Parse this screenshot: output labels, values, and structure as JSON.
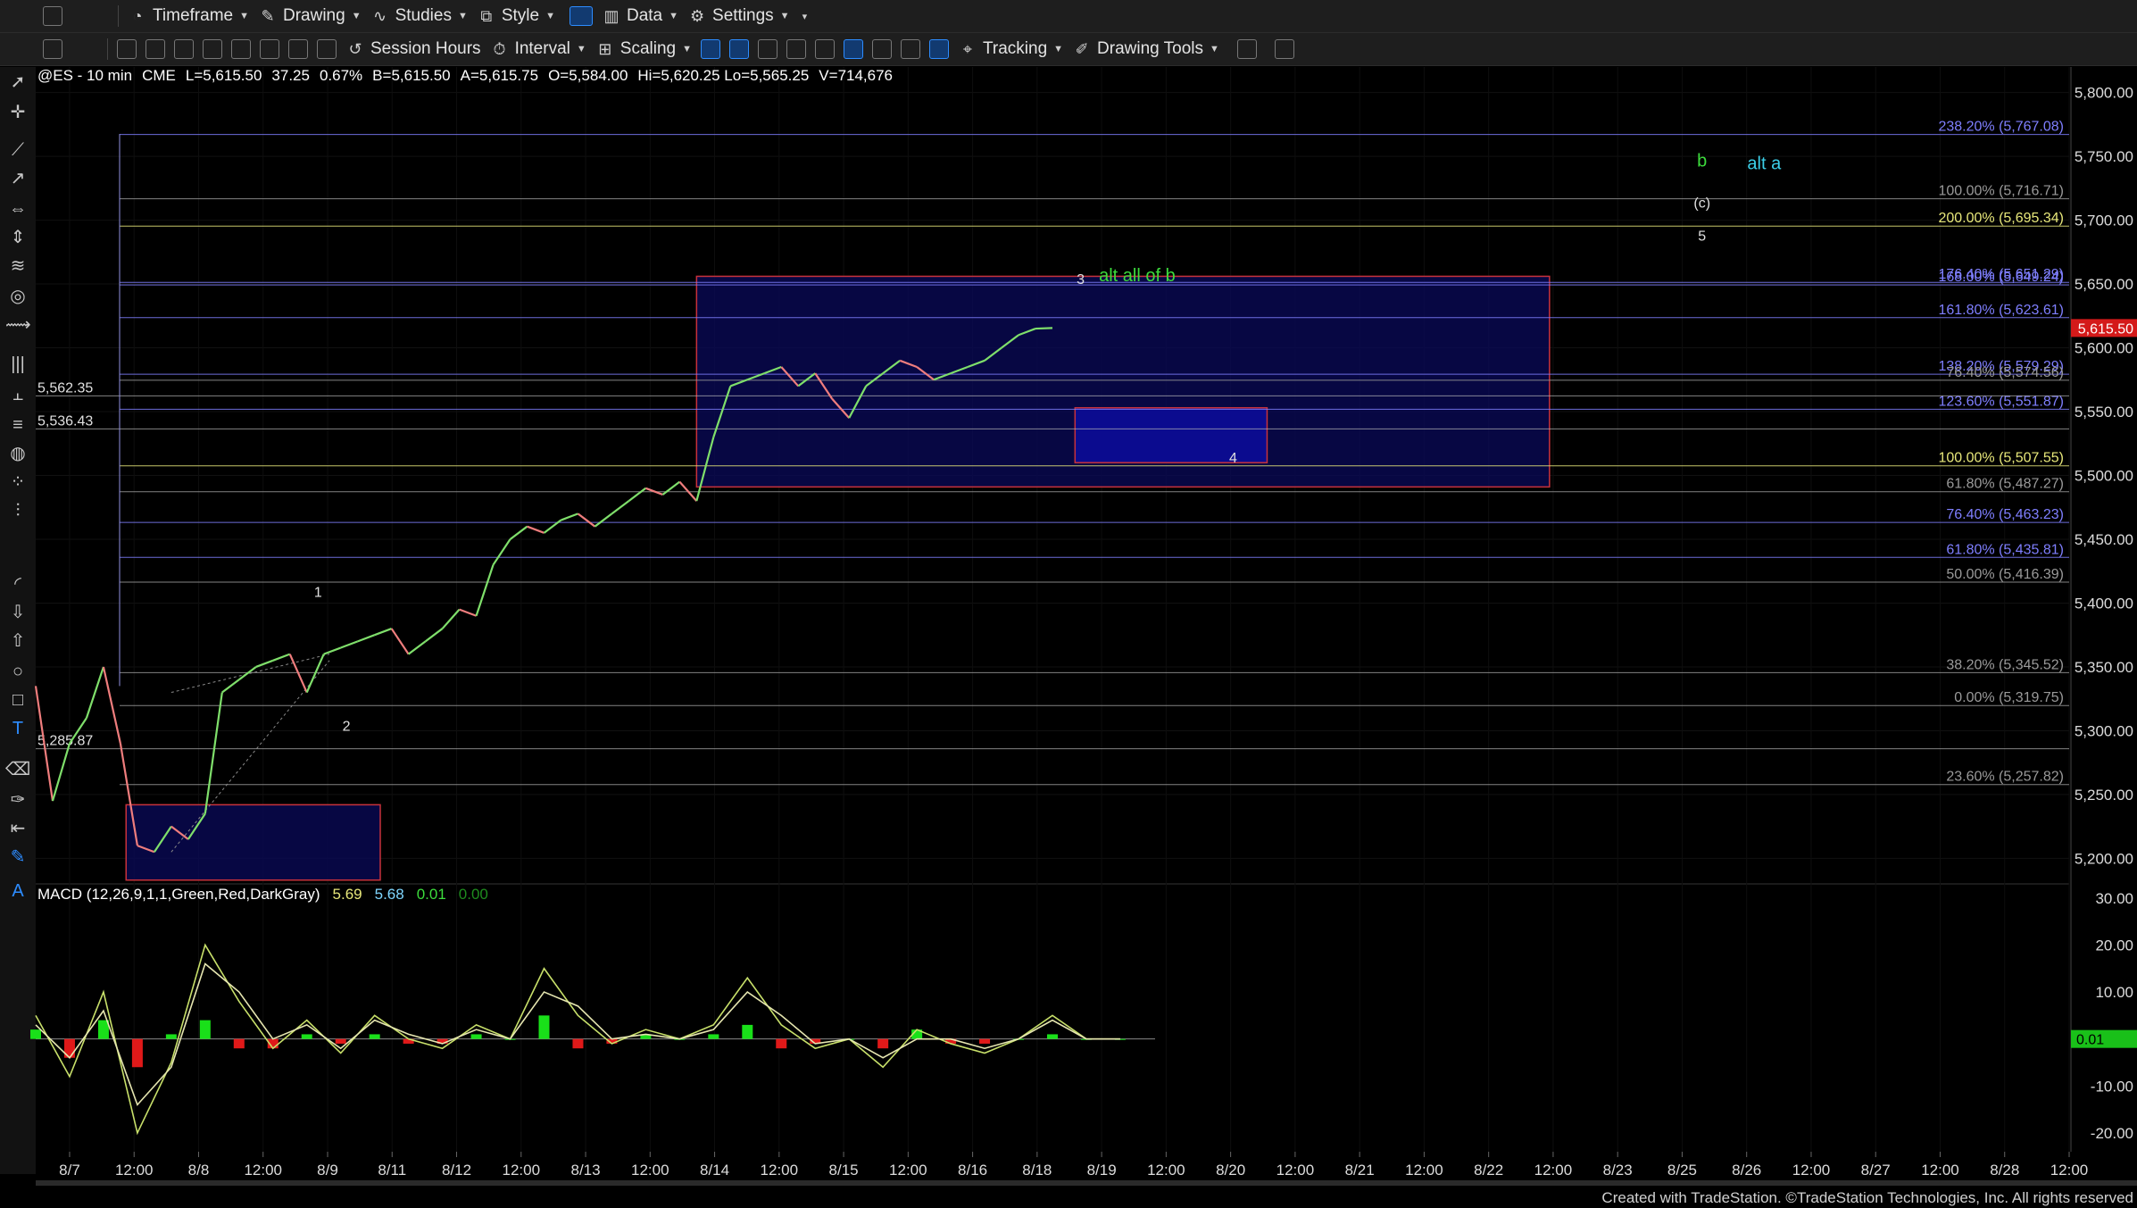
{
  "toolbar_top": {
    "timeframe": "Timeframe",
    "drawing": "Drawing",
    "studies": "Studies",
    "style": "Style",
    "data": "Data",
    "settings": "Settings"
  },
  "toolbar_second": {
    "session_hours": "Session Hours",
    "interval": "Interval",
    "scaling": "Scaling",
    "tracking": "Tracking",
    "drawing_tools": "Drawing Tools"
  },
  "symbol_header": {
    "symbol": "@ES - 10 min",
    "exchange": "CME",
    "last": "L=5,615.50",
    "change": "37.25",
    "change_pct": "0.67%",
    "bid": "B=5,615.50",
    "ask": "A=5,615.75",
    "open": "O=5,584.00",
    "hi_lo": "Hi=5,620.25  Lo=5,565.25",
    "volume": "V=714,676"
  },
  "macd_header": {
    "label": "MACD (12,26,9,1,1,Green,Red,DarkGray)",
    "macd": "5.69",
    "signal": "5.68",
    "diff": "0.01",
    "zero": "0.00"
  },
  "footer": {
    "text": "Created with TradeStation. ©TradeStation Technologies, Inc. All rights reserved"
  },
  "colors": {
    "price_up": "#7fdf6b",
    "price_down": "#ef7d7d",
    "fib_blue": "#7f7fff",
    "fib_yellow": "#e8e87a",
    "fib_gray": "#9a9a9a",
    "box_red": "#c8323c",
    "box_fill": "#0a0a5a",
    "label_green": "#3cdc3c",
    "label_cyan": "#3ccfe8",
    "last_price_bg": "#d41a1a"
  },
  "chart_data": {
    "type": "line",
    "title": "@ES - 10 min",
    "price_axis": {
      "ylim": [
        5180,
        5820
      ],
      "ticks": [
        "5,800.00",
        "5,750.00",
        "5,700.00",
        "5,650.00",
        "5,600.00",
        "5,550.00",
        "5,500.00",
        "5,450.00",
        "5,400.00",
        "5,350.00",
        "5,300.00",
        "5,250.00",
        "5,200.00"
      ],
      "tick_values": [
        5800,
        5750,
        5700,
        5650,
        5600,
        5550,
        5500,
        5450,
        5400,
        5350,
        5300,
        5250,
        5200
      ],
      "last_price_label": "5,615.50",
      "last_price": 5615.5
    },
    "time_axis": {
      "labels": [
        "8/7",
        "12:00",
        "8/8",
        "12:00",
        "8/9",
        "8/11",
        "8/12",
        "12:00",
        "8/13",
        "12:00",
        "8/14",
        "12:00",
        "8/15",
        "12:00",
        "8/16",
        "8/18",
        "8/19",
        "12:00",
        "8/20",
        "12:00",
        "8/21",
        "12:00",
        "8/22",
        "12:00",
        "8/23",
        "8/25",
        "8/26",
        "12:00",
        "8/27",
        "12:00",
        "8/28",
        "12:00"
      ],
      "xlim": [
        0,
        36
      ]
    },
    "price_series": {
      "name": "@ES",
      "x": [
        0,
        0.3,
        0.6,
        0.9,
        1.2,
        1.5,
        1.8,
        2.1,
        2.4,
        2.7,
        3.0,
        3.3,
        3.6,
        3.9,
        4.2,
        4.5,
        4.8,
        5.1,
        5.4,
        5.7,
        6.0,
        6.3,
        6.6,
        6.9,
        7.2,
        7.5,
        7.8,
        8.1,
        8.4,
        8.7,
        9.0,
        9.3,
        9.6,
        9.9,
        10.2,
        10.5,
        10.8,
        11.1,
        11.4,
        11.7,
        12.0,
        12.3,
        12.6,
        12.9,
        13.2,
        13.5,
        13.8,
        14.1,
        14.4,
        14.7,
        15.0,
        15.3,
        15.6,
        15.9,
        16.2,
        16.5,
        16.8,
        17.1,
        17.4,
        17.7,
        18.0,
        18.3,
        18.6,
        18.9,
        19.2
      ],
      "values": [
        5335,
        5245,
        5290,
        5310,
        5350,
        5290,
        5210,
        5205,
        5225,
        5215,
        5235,
        5330,
        5340,
        5350,
        5355,
        5360,
        5330,
        5360,
        5365,
        5370,
        5375,
        5380,
        5360,
        5370,
        5380,
        5395,
        5390,
        5430,
        5450,
        5460,
        5455,
        5465,
        5470,
        5460,
        5470,
        5480,
        5490,
        5485,
        5495,
        5480,
        5530,
        5570,
        5575,
        5580,
        5585,
        5570,
        5580,
        5560,
        5545,
        5570,
        5580,
        5590,
        5585,
        5575,
        5580,
        5585,
        5590,
        5600,
        5610,
        5615,
        5615.5,
        null,
        null,
        null,
        null
      ]
    },
    "horizontal_levels": [
      {
        "label": "238.20% (5,767.08)",
        "value": 5767.08,
        "color": "fib_blue"
      },
      {
        "label": "100.00% (5,716.71)",
        "value": 5716.71,
        "color": "fib_gray"
      },
      {
        "label": "200.00% (5,695.34)",
        "value": 5695.34,
        "color": "fib_yellow"
      },
      {
        "label": "176.40% (5,651.29)",
        "value": 5651.29,
        "color": "fib_blue"
      },
      {
        "label": "168.00% (5,649.24)",
        "value": 5649.24,
        "color": "fib_blue"
      },
      {
        "label": "161.80% (5,623.61)",
        "value": 5623.61,
        "color": "fib_blue"
      },
      {
        "label": "138.20% (5,579.29)",
        "value": 5579.29,
        "color": "fib_blue"
      },
      {
        "label": "76.40% (5,574.56)",
        "value": 5574.56,
        "color": "fib_gray"
      },
      {
        "label": "123.60% (5,551.87)",
        "value": 5551.87,
        "color": "fib_blue"
      },
      {
        "label": "100.00% (5,507.55)",
        "value": 5507.55,
        "color": "fib_yellow"
      },
      {
        "label": "61.80% (5,487.27)",
        "value": 5487.27,
        "color": "fib_gray"
      },
      {
        "label": "76.40% (5,463.23)",
        "value": 5463.23,
        "color": "fib_blue"
      },
      {
        "label": "61.80% (5,435.81)",
        "value": 5435.81,
        "color": "fib_blue"
      },
      {
        "label": "50.00% (5,416.39)",
        "value": 5416.39,
        "color": "fib_gray"
      },
      {
        "label": "38.20% (5,345.52)",
        "value": 5345.52,
        "color": "fib_gray"
      },
      {
        "label": "0.00% (5,319.75)",
        "value": 5319.75,
        "color": "fib_gray"
      },
      {
        "label": "23.60% (5,257.82)",
        "value": 5257.82,
        "color": "fib_gray"
      }
    ],
    "left_price_labels": [
      {
        "label": "5,562.35",
        "value": 5562.35
      },
      {
        "label": "5,536.43",
        "value": 5536.43
      },
      {
        "label": "5,285.87",
        "value": 5285.87
      }
    ],
    "wave_labels": [
      {
        "text": "1",
        "x": 5.0,
        "value": 5405
      },
      {
        "text": "2",
        "x": 5.5,
        "value": 5300
      },
      {
        "text": "3",
        "x": 18.5,
        "value": 5650
      },
      {
        "text": "alt all of b",
        "x": 19.5,
        "value": 5652
      },
      {
        "text": "4",
        "x": 21.2,
        "value": 5510
      },
      {
        "text": "b",
        "x": 29.5,
        "value": 5742
      },
      {
        "text": "alt a",
        "x": 30.6,
        "value": 5740
      },
      {
        "text": "(c)",
        "x": 29.5,
        "value": 5710
      },
      {
        "text": "5",
        "x": 29.5,
        "value": 5684
      }
    ],
    "boxes": [
      {
        "x0": 11.7,
        "x1": 26.8,
        "y0": 5491,
        "y1": 5656,
        "kind": "target-zone"
      },
      {
        "x0": 18.4,
        "x1": 21.8,
        "y0": 5510,
        "y1": 5553,
        "kind": "wave-4-zone"
      },
      {
        "x0": 1.6,
        "x1": 6.1,
        "y0": 5183,
        "y1": 5242,
        "kind": "support-zone"
      }
    ],
    "macd": {
      "axis_ticks": [
        "30.00",
        "20.00",
        "10.00",
        "0.00",
        "-10.00",
        "-20.00"
      ],
      "axis_values": [
        30,
        20,
        10,
        0,
        -10,
        -20
      ],
      "ylim": [
        -24,
        33
      ],
      "current_label": "0.01",
      "x": [
        0,
        0.6,
        1.2,
        1.8,
        2.4,
        3.0,
        3.6,
        4.2,
        4.8,
        5.4,
        6.0,
        6.6,
        7.2,
        7.8,
        8.4,
        9.0,
        9.6,
        10.2,
        10.8,
        11.4,
        12.0,
        12.6,
        13.2,
        13.8,
        14.4,
        15.0,
        15.6,
        16.2,
        16.8,
        17.4,
        18.0,
        18.6,
        19.2
      ],
      "macd_values": [
        5,
        -8,
        10,
        -20,
        -5,
        20,
        8,
        -2,
        4,
        -3,
        5,
        0,
        -2,
        3,
        0,
        15,
        5,
        -1,
        2,
        0,
        3,
        13,
        3,
        -2,
        0,
        -6,
        2,
        -1,
        -3,
        0,
        5,
        0,
        0
      ],
      "signal_values": [
        3,
        -4,
        6,
        -14,
        -6,
        16,
        10,
        0,
        3,
        -2,
        4,
        1,
        -1,
        2,
        0,
        10,
        7,
        0,
        1,
        0,
        2,
        10,
        5,
        -1,
        0,
        -4,
        0,
        0,
        -2,
        0,
        4,
        0,
        0
      ]
    }
  }
}
